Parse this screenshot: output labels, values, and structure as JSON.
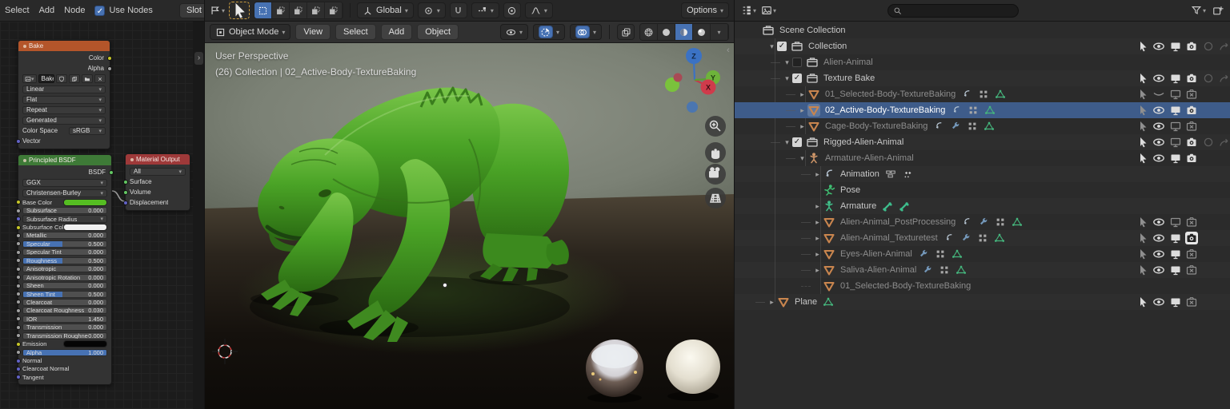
{
  "colors": {
    "accent": "#4772b3",
    "selection_row": "#3e5c8a",
    "node_header_texture": "#b4552a",
    "node_header_shader": "#3e7a37",
    "node_header_output": "#9e3939",
    "base_color_swatch": "#55bd22",
    "creature_green": "#4aa326"
  },
  "shader_editor": {
    "menus": [
      "Select",
      "Add",
      "Node"
    ],
    "use_nodes_label": "Use Nodes",
    "slot_label": "Slot",
    "nodes": {
      "bake": {
        "title": "Bake",
        "image_name": "Bake",
        "rows": [
          {
            "t": "out",
            "label": "Color",
            "sock": "#c7c729"
          },
          {
            "t": "out",
            "label": "Alpha",
            "sock": "#a1a1a1"
          },
          {
            "t": "img",
            "name": "Bake"
          },
          {
            "t": "dd",
            "label": "Linear"
          },
          {
            "t": "dd",
            "label": "Flat"
          },
          {
            "t": "dd",
            "label": "Repeat"
          },
          {
            "t": "dd",
            "label": "Generated"
          },
          {
            "t": "cs",
            "label": "Color Space",
            "value": "sRGB"
          },
          {
            "t": "in",
            "label": "Vector",
            "sock": "#6363c7"
          }
        ]
      },
      "principled": {
        "title": "Principled BSDF",
        "rows": [
          {
            "t": "out",
            "label": "BSDF",
            "sock": "#63c763"
          },
          {
            "t": "dd",
            "label": "GGX"
          },
          {
            "t": "dd",
            "label": "Christensen-Burley"
          },
          {
            "t": "color",
            "label": "Base Color",
            "swatch": "#55bd22",
            "sock": "#c7c729",
            "small": true
          },
          {
            "t": "val",
            "label": "Subsurface",
            "value": "0.000",
            "sock": "#a1a1a1",
            "small": true
          },
          {
            "t": "dd2",
            "label": "Subsurface Radius",
            "sock": "#6363c7",
            "small": true
          },
          {
            "t": "color",
            "label": "Subsurface Color",
            "swatch": "#f0f0f0",
            "sock": "#c7c729",
            "small": true
          },
          {
            "t": "val",
            "label": "Metallic",
            "value": "0.000",
            "sock": "#a1a1a1",
            "small": true
          },
          {
            "t": "slider",
            "label": "Specular",
            "value": "0.500",
            "fill": 0.47,
            "sock": "#a1a1a1",
            "small": true
          },
          {
            "t": "val",
            "label": "Specular Tint",
            "value": "0.000",
            "sock": "#a1a1a1",
            "small": true
          },
          {
            "t": "slider",
            "label": "Roughness",
            "value": "0.500",
            "fill": 0.47,
            "sock": "#a1a1a1",
            "small": true
          },
          {
            "t": "val",
            "label": "Anisotropic",
            "value": "0.000",
            "sock": "#a1a1a1",
            "small": true
          },
          {
            "t": "val",
            "label": "Anisotropic Rotation",
            "value": "0.000",
            "sock": "#a1a1a1",
            "small": true
          },
          {
            "t": "val",
            "label": "Sheen",
            "value": "0.000",
            "sock": "#a1a1a1",
            "small": true
          },
          {
            "t": "slider",
            "label": "Sheen Tint",
            "value": "0.500",
            "fill": 0.47,
            "sock": "#a1a1a1",
            "small": true
          },
          {
            "t": "val",
            "label": "Clearcoat",
            "value": "0.000",
            "sock": "#a1a1a1",
            "small": true
          },
          {
            "t": "val",
            "label": "Clearcoat Roughness",
            "value": "0.030",
            "sock": "#a1a1a1",
            "small": true
          },
          {
            "t": "val",
            "label": "IOR",
            "value": "1.450",
            "sock": "#a1a1a1",
            "small": true
          },
          {
            "t": "val",
            "label": "Transmission",
            "value": "0.000",
            "sock": "#a1a1a1",
            "small": true
          },
          {
            "t": "val",
            "label": "Transmission Roughness",
            "value": "0.000",
            "sock": "#a1a1a1",
            "small": true
          },
          {
            "t": "color",
            "label": "Emission",
            "swatch": "#050505",
            "sock": "#c7c729",
            "small": true
          },
          {
            "t": "slider",
            "label": "Alpha",
            "value": "1.000",
            "fill": 1,
            "sock": "#a1a1a1",
            "small": true
          },
          {
            "t": "plain",
            "label": "Normal",
            "sock": "#6363c7",
            "small": true
          },
          {
            "t": "plain",
            "label": "Clearcoat Normal",
            "sock": "#6363c7",
            "small": true
          },
          {
            "t": "plain",
            "label": "Tangent",
            "sock": "#6363c7",
            "small": true
          }
        ]
      },
      "output": {
        "title": "Material Output",
        "rows": [
          {
            "t": "dd",
            "label": "All"
          },
          {
            "t": "in",
            "label": "Surface",
            "sock": "#63c763"
          },
          {
            "t": "in",
            "label": "Volume",
            "sock": "#63c763"
          },
          {
            "t": "in",
            "label": "Displacement",
            "sock": "#6363c7"
          }
        ]
      }
    }
  },
  "viewport": {
    "tool_settings": {
      "orientation": "Global",
      "options_label": "Options"
    },
    "header": {
      "mode_label": "Object Mode",
      "menus": [
        "View",
        "Select",
        "Add",
        "Object"
      ]
    },
    "overlay": {
      "line1": "User Perspective",
      "line2": "(26) Collection | 02_Active-Body-TextureBaking"
    },
    "axis_labels": {
      "z": "Z",
      "y": "Y",
      "x": "X"
    }
  },
  "outliner": {
    "rows": [
      {
        "label": "Scene Collection",
        "level": 0,
        "icon": "collection"
      },
      {
        "label": "Collection",
        "level": 1,
        "disc": "open",
        "cb": true,
        "icon": "collection",
        "toggles": [
          [
            "cursor",
            2
          ],
          [
            "eye",
            2
          ],
          [
            "monitor",
            2
          ],
          [
            "camera",
            2
          ],
          [
            "holdout",
            0
          ],
          [
            "indirect",
            0
          ]
        ]
      },
      {
        "label": "Alien-Animal",
        "level": 2,
        "disc": "open",
        "cb": false,
        "icon": "collection",
        "dim": true,
        "stub": true
      },
      {
        "label": "Texture Bake",
        "level": 2,
        "disc": "open",
        "cb": true,
        "icon": "collection",
        "stub": true,
        "toggles": [
          [
            "cursor",
            2
          ],
          [
            "eye",
            2
          ],
          [
            "monitor",
            2
          ],
          [
            "camera",
            2
          ],
          [
            "holdout",
            0
          ],
          [
            "indirect",
            0
          ]
        ]
      },
      {
        "label": "01_Selected-Body-TextureBaking",
        "level": 3,
        "disc": "closed",
        "icon": "mesh",
        "dim": true,
        "stub": true,
        "trailing": [
          "action",
          "modifier",
          "meshdata"
        ],
        "toggles": [
          [
            "cursor",
            1
          ],
          [
            "eye-closed",
            1
          ],
          [
            "monitor-off",
            1
          ],
          [
            "camera-x",
            1
          ]
        ]
      },
      {
        "label": "02_Active-Body-TextureBaking",
        "level": 3,
        "disc": "closed",
        "icon": "mesh",
        "selected": true,
        "active": true,
        "stub": true,
        "trailing": [
          "action",
          "modifier",
          "meshdata"
        ],
        "toggles": [
          [
            "cursor",
            1
          ],
          [
            "eye",
            2
          ],
          [
            "monitor",
            2
          ],
          [
            "camera",
            2
          ]
        ]
      },
      {
        "label": "Cage-Body-TextureBaking",
        "level": 3,
        "disc": "closed",
        "icon": "mesh",
        "dim": true,
        "stub": true,
        "trailing": [
          "action",
          "wrench",
          "modifier",
          "meshdata"
        ],
        "toggles": [
          [
            "cursor",
            1
          ],
          [
            "eye",
            2
          ],
          [
            "monitor-off",
            1
          ],
          [
            "camera-x",
            1
          ]
        ]
      },
      {
        "label": "Rigged-Alien-Animal",
        "level": 2,
        "disc": "open",
        "cb": true,
        "icon": "collection",
        "stub": true,
        "toggles": [
          [
            "cursor",
            2
          ],
          [
            "eye",
            2
          ],
          [
            "monitor-off",
            1
          ],
          [
            "camera",
            2
          ],
          [
            "holdout",
            0
          ],
          [
            "indirect",
            0
          ]
        ]
      },
      {
        "label": "Armature-Alien-Animal",
        "level": 3,
        "disc": "open",
        "icon": "armature-o",
        "dim": true,
        "stub": true,
        "toggles": [
          [
            "cursor",
            2
          ],
          [
            "eye",
            2
          ],
          [
            "monitor",
            2
          ],
          [
            "camera",
            2
          ]
        ]
      },
      {
        "label": "Animation",
        "level": 4,
        "disc": "closed",
        "icon": "action",
        "stub": true,
        "trailing": [
          "nla",
          "keys"
        ]
      },
      {
        "label": "Pose",
        "level": 4,
        "icon": "pose"
      },
      {
        "label": "Armature",
        "level": 4,
        "disc": "closed",
        "icon": "armature-g",
        "trailing": [
          "bone",
          "bone"
        ]
      },
      {
        "label": "Alien-Animal_PostProcessing",
        "level": 4,
        "disc": "closed",
        "icon": "mesh",
        "dim": true,
        "stub": true,
        "trailing": [
          "action",
          "wrench",
          "modifier",
          "meshdata"
        ],
        "toggles": [
          [
            "cursor",
            1
          ],
          [
            "eye",
            2
          ],
          [
            "monitor-off",
            1
          ],
          [
            "camera-x",
            1
          ]
        ]
      },
      {
        "label": "Alien-Animal_Texturetest",
        "level": 4,
        "disc": "closed",
        "icon": "mesh",
        "dim": true,
        "stub": true,
        "trailing": [
          "action",
          "wrench",
          "modifier",
          "meshdata"
        ],
        "toggles": [
          [
            "cursor",
            1
          ],
          [
            "eye",
            2
          ],
          [
            "monitor",
            2
          ],
          [
            "camera-hl",
            2
          ]
        ]
      },
      {
        "label": "Eyes-Alien-Animal",
        "level": 4,
        "disc": "closed",
        "icon": "mesh",
        "dim": true,
        "stub": true,
        "trailing": [
          "wrench",
          "modifier",
          "meshdata"
        ],
        "toggles": [
          [
            "cursor",
            1
          ],
          [
            "eye",
            2
          ],
          [
            "monitor",
            2
          ],
          [
            "camera-x",
            1
          ]
        ]
      },
      {
        "label": "Saliva-Alien-Animal",
        "level": 4,
        "disc": "closed",
        "icon": "mesh",
        "dim": true,
        "stub": true,
        "trailing": [
          "wrench",
          "modifier",
          "meshdata"
        ],
        "toggles": [
          [
            "cursor",
            1
          ],
          [
            "eye",
            2
          ],
          [
            "monitor",
            2
          ],
          [
            "camera-x",
            1
          ]
        ]
      },
      {
        "label": "01_Selected-Body-TextureBaking",
        "level": 4,
        "icon": "mesh",
        "dim": true,
        "stub": true,
        "dashed": true
      },
      {
        "label": "Plane",
        "level": 1,
        "disc": "closed",
        "icon": "mesh",
        "stub": true,
        "trailing": [
          "meshdata"
        ],
        "toggles": [
          [
            "cursor",
            2
          ],
          [
            "eye",
            2
          ],
          [
            "monitor",
            2
          ],
          [
            "camera-x",
            1
          ]
        ]
      }
    ]
  }
}
